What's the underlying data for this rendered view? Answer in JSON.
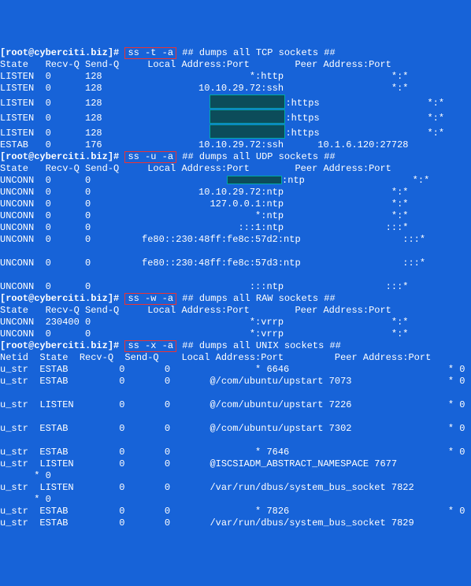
{
  "prompt": "[root@cyberciti.biz]#",
  "sections": [
    {
      "cmd": "ss -t -a",
      "comment": "## dumps all TCP sockets ##",
      "header": [
        "State",
        "Recv-Q",
        "Send-Q",
        "Local Address:Port",
        "Peer Address:Port"
      ],
      "rows": [
        {
          "c": [
            "LISTEN",
            "0",
            "128",
            "*:http",
            "*:*"
          ]
        },
        {
          "c": [
            "LISTEN",
            "0",
            "128",
            "10.10.29.72:ssh",
            "*:*"
          ]
        },
        {
          "c": [
            "LISTEN",
            "0",
            "128",
            "REDACT_LG:https",
            "*:*"
          ]
        },
        {
          "c": [
            "LISTEN",
            "0",
            "128",
            "REDACT_LG:https",
            "*:*"
          ]
        },
        {
          "c": [
            "LISTEN",
            "0",
            "128",
            "REDACT_LG:https",
            "*:*"
          ]
        },
        {
          "c": [
            "ESTAB",
            "0",
            "176",
            "10.10.29.72:ssh",
            "10.1.6.120:27728"
          ]
        }
      ]
    },
    {
      "cmd": "ss -u -a",
      "comment": "## dumps all UDP sockets ##",
      "header": [
        "State",
        "Recv-Q",
        "Send-Q",
        "Local Address:Port",
        "Peer Address:Port"
      ],
      "rows": [
        {
          "c": [
            "UNCONN",
            "0",
            "0",
            "REDACT_SM:ntp",
            "*:*"
          ]
        },
        {
          "c": [
            "UNCONN",
            "0",
            "0",
            "10.10.29.72:ntp",
            "*:*"
          ]
        },
        {
          "c": [
            "UNCONN",
            "0",
            "0",
            "127.0.0.1:ntp",
            "*:*"
          ]
        },
        {
          "c": [
            "UNCONN",
            "0",
            "0",
            "*:ntp",
            "*:*"
          ]
        },
        {
          "c": [
            "UNCONN",
            "0",
            "0",
            ":::1:ntp",
            ":::*"
          ]
        },
        {
          "c": [
            "UNCONN",
            "0",
            "0",
            "fe80::230:48ff:fe8c:57d2:ntp",
            ":::*"
          ],
          "wide": true
        },
        {
          "blank": true
        },
        {
          "c": [
            "UNCONN",
            "0",
            "0",
            "fe80::230:48ff:fe8c:57d3:ntp",
            ":::*"
          ],
          "wide": true
        },
        {
          "blank": true
        },
        {
          "c": [
            "UNCONN",
            "0",
            "0",
            ":::ntp",
            ":::*"
          ]
        }
      ]
    },
    {
      "cmd": "ss -w -a",
      "comment": "## dumps all RAW sockets ##",
      "header": [
        "State",
        "Recv-Q",
        "Send-Q",
        "Local Address:Port",
        "Peer Address:Port"
      ],
      "rows": [
        {
          "c": [
            "UNCONN",
            "230400",
            "0",
            "*:vrrp",
            "*:*"
          ]
        },
        {
          "c": [
            "UNCONN",
            "0",
            "0",
            "*:vrrp",
            "*:*"
          ]
        }
      ]
    },
    {
      "cmd": "ss -x -a",
      "comment": "## dumps all UNIX sockets ##",
      "header": [
        "Netid",
        "State",
        "Recv-Q",
        "Send-Q",
        "Local Address:Port",
        "Peer Address:Port"
      ],
      "rows": [
        {
          "c": [
            "u_str",
            "ESTAB",
            "0",
            "0",
            "* 6646",
            "* 0"
          ]
        },
        {
          "c": [
            "u_str",
            "ESTAB",
            "0",
            "0",
            "@/com/ubuntu/upstart 7073",
            "* 0"
          ]
        },
        {
          "blank": true
        },
        {
          "c": [
            "u_str",
            "LISTEN",
            "0",
            "0",
            "@/com/ubuntu/upstart 7226",
            "* 0"
          ]
        },
        {
          "blank": true
        },
        {
          "c": [
            "u_str",
            "ESTAB",
            "0",
            "0",
            "@/com/ubuntu/upstart 7302",
            "* 0"
          ]
        },
        {
          "blank": true
        },
        {
          "c": [
            "u_str",
            "ESTAB",
            "0",
            "0",
            "* 7646",
            "* 0"
          ]
        },
        {
          "c": [
            "u_str",
            "LISTEN",
            "0",
            "0",
            "@ISCSIADM_ABSTRACT_NAMESPACE 7677",
            ""
          ]
        },
        {
          "cont": "* 0"
        },
        {
          "c": [
            "u_str",
            "LISTEN",
            "0",
            "0",
            "/var/run/dbus/system_bus_socket 7822",
            ""
          ]
        },
        {
          "cont": "* 0"
        },
        {
          "c": [
            "u_str",
            "ESTAB",
            "0",
            "0",
            "* 7826",
            "* 0"
          ]
        },
        {
          "c": [
            "u_str",
            "ESTAB",
            "0",
            "0",
            "/var/run/dbus/system_bus_socket 7829",
            ""
          ]
        }
      ]
    }
  ]
}
